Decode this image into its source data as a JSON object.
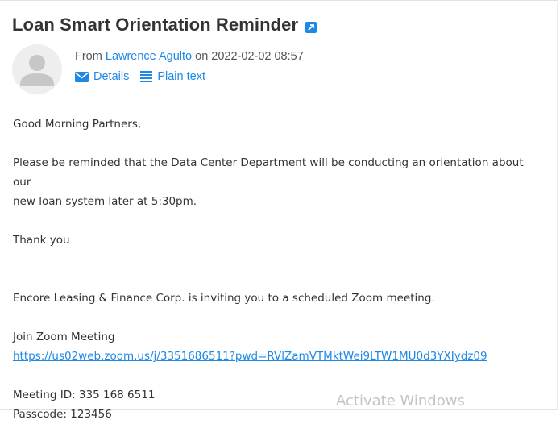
{
  "email": {
    "subject": "Loan Smart Orientation Reminder",
    "from_prefix": "From",
    "sender_name": "Lawrence Agulto",
    "on_word": "on",
    "date": "2022-02-02 08:57",
    "details_label": "Details",
    "plain_text_label": "Plain text",
    "body": {
      "greeting": "Good Morning Partners,",
      "para1_line1": "Please be reminded that the Data Center Department will be conducting an orientation about our",
      "para1_line2": "new loan system later at 5:30pm.",
      "thanks": "Thank you",
      "invite": "Encore Leasing & Finance Corp. is inviting you to a scheduled Zoom meeting.",
      "join_label": "Join Zoom Meeting",
      "join_url": "https://us02web.zoom.us/j/3351686511?pwd=RVlZamVTMktWei9LTW1MU0d3YXIydz09",
      "meeting_id": "Meeting ID: 335 168 6511",
      "passcode": "Passcode: 123456"
    }
  },
  "watermark": "Activate Windows",
  "colors": {
    "accent": "#1e88e5",
    "text": "#333333"
  },
  "icons": [
    "open-external-icon",
    "avatar-placeholder-icon",
    "envelope-icon",
    "list-lines-icon"
  ]
}
